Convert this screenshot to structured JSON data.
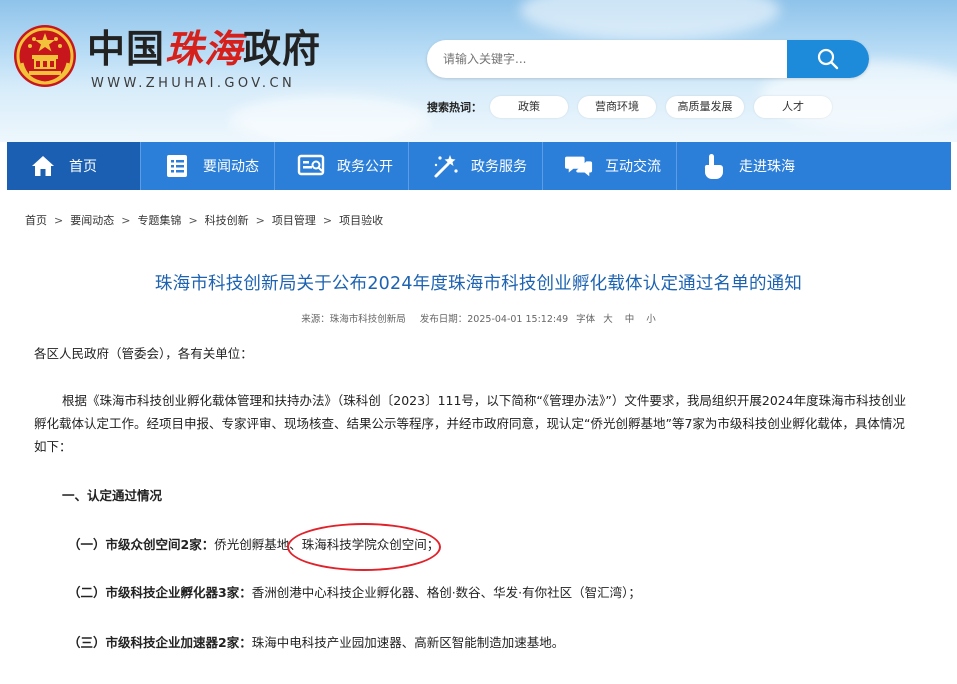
{
  "header": {
    "title_prefix": "中国",
    "title_highlight": "珠海",
    "title_suffix": "政府",
    "domain": "WWW.ZHUHAI.GOV.CN"
  },
  "search": {
    "placeholder": "请输入关键字..."
  },
  "hot": {
    "label": "搜索热词：",
    "tags": [
      "政策",
      "营商环境",
      "高质量发展",
      "人才"
    ]
  },
  "nav": {
    "items": [
      {
        "label": "首页",
        "icon": "home-icon"
      },
      {
        "label": "要闻动态",
        "icon": "news-list-icon"
      },
      {
        "label": "政务公开",
        "icon": "public-info-icon"
      },
      {
        "label": "政务服务",
        "icon": "service-wand-icon"
      },
      {
        "label": "互动交流",
        "icon": "chat-bubbles-icon"
      },
      {
        "label": "走进珠海",
        "icon": "hand-pointer-icon"
      }
    ]
  },
  "breadcrumb": [
    "首页",
    "要闻动态",
    "专题集锦",
    "科技创新",
    "项目管理",
    "项目验收"
  ],
  "article": {
    "title": "珠海市科技创新局关于公布2024年度珠海市科技创业孵化载体认定通过名单的通知",
    "source": "来源：珠海市科技创新局",
    "date": "发布日期：2025-04-01 15:12:49",
    "font_label": "字体",
    "font_sizes": [
      "大",
      "中",
      "小"
    ],
    "addressee": "各区人民政府（管委会），各有关单位：",
    "body": "根据《珠海市科技创业孵化载体管理和扶持办法》（珠科创〔2023〕111号，以下简称“《管理办法》”）文件要求，我局组织开展2024年度珠海市科技创业孵化载体认定工作。经项目申报、专家评审、现场核查、结果公示等程序，并经市政府同意，现认定“侨光创孵基地”等7家为市级科技创业孵化载体，具体情况如下：",
    "section1": "一、认定通过情况",
    "items": [
      {
        "head": "（一）市级众创空间2家：",
        "text": "侨光创孵基地、珠海科技学院众创空间；"
      },
      {
        "head": "（二）市级科技企业孵化器3家：",
        "text": "香洲创港中心科技企业孵化器、格创·数谷、华发·有你社区（智汇湾）；"
      },
      {
        "head": "（三）市级科技企业加速器2家：",
        "text": "珠海中电科技产业园加速器、高新区智能制造加速基地。"
      }
    ]
  },
  "colors": {
    "nav_bg": "#2c7fd9",
    "nav_active": "#1a5fb2",
    "title_blue": "#1e63b2",
    "highlight_red": "#d6201b",
    "annotation_red": "#e0222a",
    "search_button": "#1d8bd9"
  }
}
